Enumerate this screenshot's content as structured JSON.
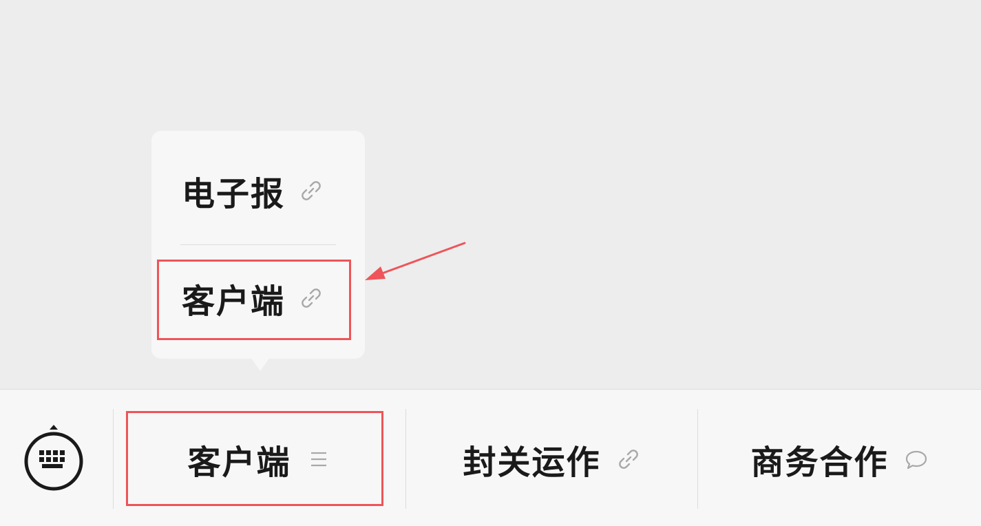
{
  "popup": {
    "items": [
      {
        "label": "电子报",
        "icon": "link-icon"
      },
      {
        "label": "客户端",
        "icon": "link-icon"
      }
    ]
  },
  "menubar": {
    "keyboard_icon": "keyboard-icon",
    "items": [
      {
        "label": "客户端",
        "icon": "menu-lines-icon"
      },
      {
        "label": "封关运作",
        "icon": "link-icon"
      },
      {
        "label": "商务合作",
        "icon": "chat-bubble-icon"
      }
    ]
  },
  "annotations": {
    "color": "#ee5459"
  }
}
